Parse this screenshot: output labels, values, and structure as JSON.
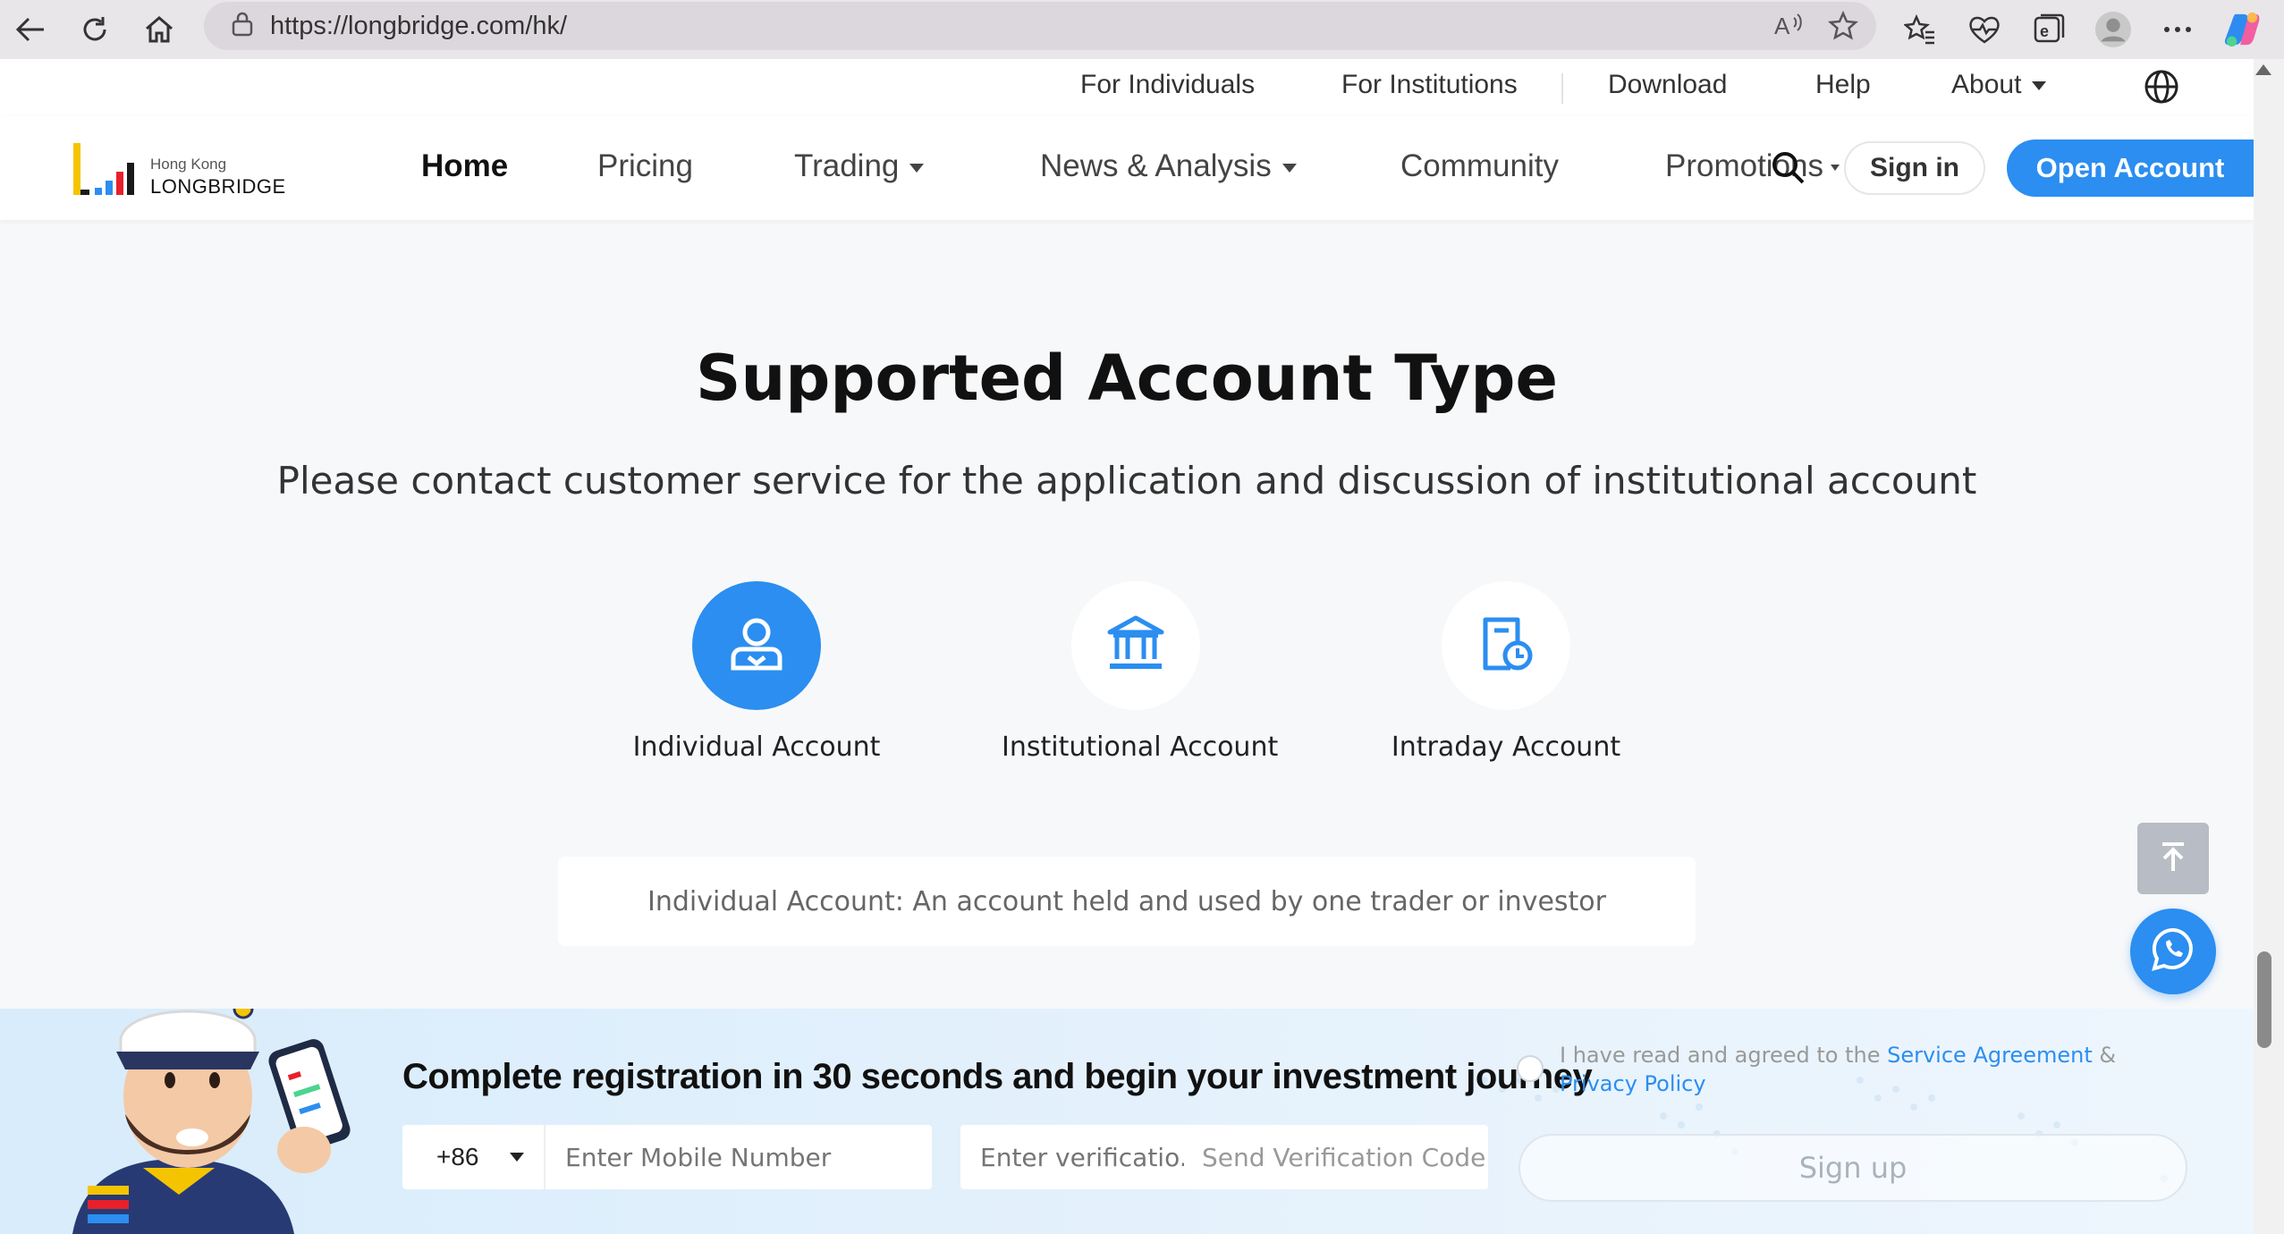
{
  "browser": {
    "url": "https://longbridge.com/hk/"
  },
  "util_nav": {
    "items": [
      "For Individuals",
      "For Institutions",
      "Download",
      "Help",
      "About"
    ]
  },
  "brand": {
    "region": "Hong Kong",
    "name": "LONGBRIDGE"
  },
  "main_nav": {
    "items": [
      "Home",
      "Pricing",
      "Trading",
      "News & Analysis",
      "Community",
      "Promotions"
    ],
    "sign_in": "Sign in",
    "open_account": "Open Account"
  },
  "section": {
    "title": "Supported Account Type",
    "subtitle": "Please contact customer service for the application and discussion of institutional account",
    "accounts": [
      {
        "label": "Individual Account",
        "selected": true
      },
      {
        "label": "Institutional Account",
        "selected": false
      },
      {
        "label": "Intraday Account",
        "selected": false
      }
    ],
    "description": "Individual Account: An account held and used by one trader or investor"
  },
  "banner": {
    "title": "Complete registration in 30 seconds and begin your investment journey",
    "country_code": "+86",
    "phone_placeholder": "Enter Mobile Number",
    "code_placeholder": "Enter verificatio...",
    "send_code": "Send Verification Code",
    "agree_prefix": "I have read and agreed to the",
    "service_agreement": "Service Agreement",
    "ampersand": "&",
    "privacy_policy": "Privacy Policy",
    "sign_up": "Sign up"
  },
  "colors": {
    "accent": "#2b8ef0",
    "banner_bg": "#d8ecfb"
  }
}
